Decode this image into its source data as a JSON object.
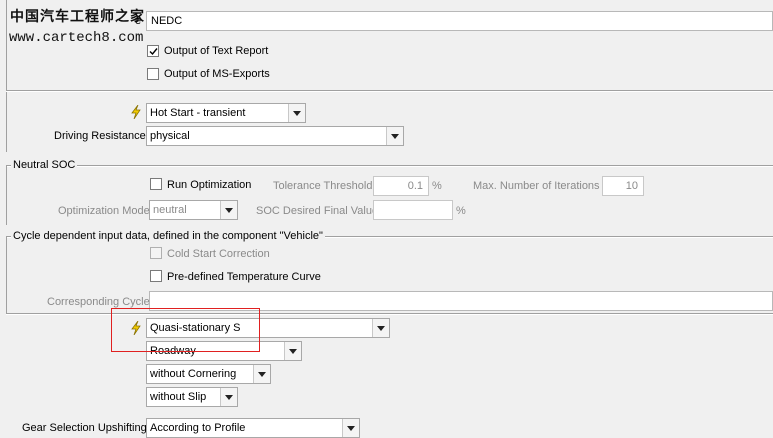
{
  "watermark": {
    "line1": "中国汽车工程师之家",
    "line2": "www.cartech8.com"
  },
  "top": {
    "name_label_suffix": "e",
    "name_value": "NEDC",
    "output_text_report": {
      "label": "Output of Text Report",
      "checked": true
    },
    "output_ms_exports": {
      "label": "Output of MS-Exports",
      "checked": false
    }
  },
  "start": {
    "icon": "lightning-bolt-icon",
    "start_value": "Hot Start - transient",
    "driving_resistance_label": "Driving Resistance",
    "driving_resistance_value": "physical"
  },
  "neutral_soc": {
    "legend": "Neutral SOC",
    "run_optimization": {
      "label": "Run Optimization",
      "checked": false
    },
    "tolerance_label": "Tolerance Threshold",
    "tolerance_value": "0.1",
    "tolerance_unit": "%",
    "max_iterations_label": "Max. Number of Iterations",
    "max_iterations_value": "10",
    "optimization_mode_label": "Optimization Mode",
    "optimization_mode_value": "neutral",
    "soc_final_label": "SOC Desired Final Value",
    "soc_final_value": "",
    "soc_final_unit": "%"
  },
  "cycle_dependent": {
    "legend": "Cycle dependent input data, defined in the component \"Vehicle\"",
    "cold_start": {
      "label": "Cold Start Correction",
      "checked": false,
      "enabled": false
    },
    "predefined_temp": {
      "label": "Pre-defined Temperature Curve",
      "checked": false
    },
    "corresponding_cycle_label": "Corresponding Cycle",
    "corresponding_cycle_value": ""
  },
  "simulation": {
    "icon": "lightning-bolt-icon",
    "mode_value": "Quasi-stationary S",
    "road_value": "Roadway",
    "cornering_value": "without Cornering",
    "slip_value": "without Slip",
    "gear_label": "Gear Selection Upshifting",
    "gear_value": "According to Profile"
  },
  "colors": {
    "highlight_box": "#e02020",
    "bolt": "#d8b000"
  }
}
